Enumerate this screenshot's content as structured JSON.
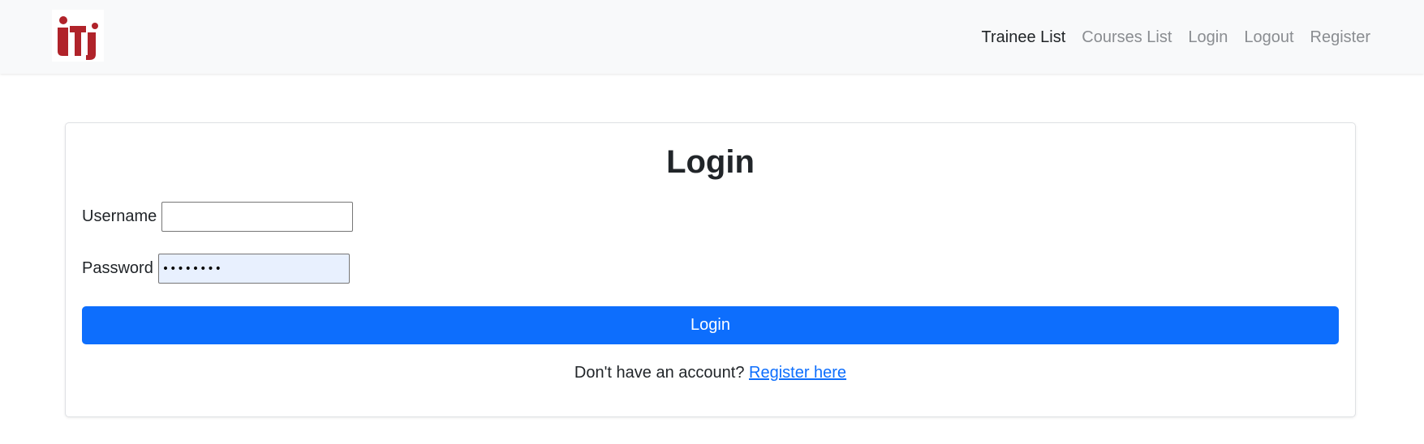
{
  "brand": {
    "logo_name": "iti-logo",
    "logo_text": "iti",
    "logo_color": "#b0232a"
  },
  "nav": {
    "items": [
      {
        "label": "Trainee List",
        "active": true
      },
      {
        "label": "Courses List",
        "active": false
      },
      {
        "label": "Login",
        "active": false
      },
      {
        "label": "Logout",
        "active": false
      },
      {
        "label": "Register",
        "active": false
      }
    ]
  },
  "login_form": {
    "title": "Login",
    "username_label": "Username",
    "username_value": "",
    "password_label": "Password",
    "password_value": "••••••••",
    "submit_label": "Login",
    "submit_color": "#0d6efd"
  },
  "footer_prompt": {
    "text": "Don't have an account? ",
    "link_label": "Register here",
    "link_color": "#0d6efd"
  }
}
